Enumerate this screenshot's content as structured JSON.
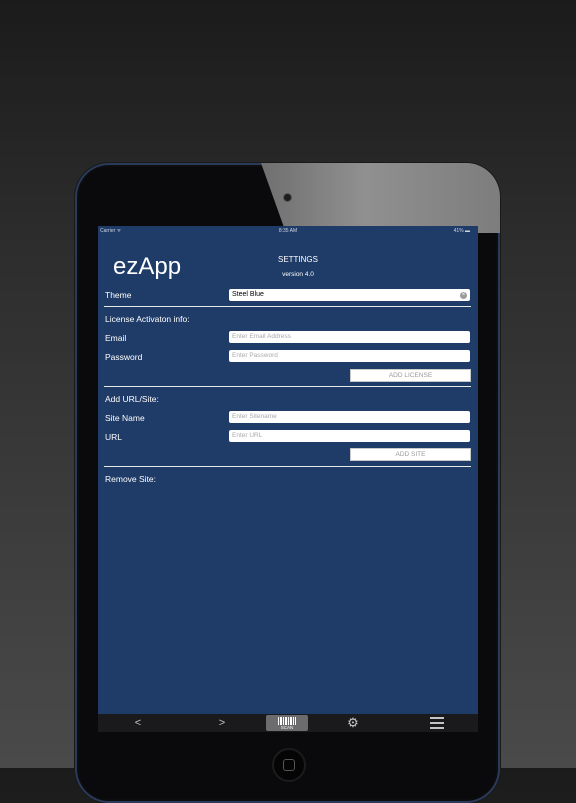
{
  "status_bar": {
    "carrier": "Carrier ᯤ",
    "time": "8:35 AM",
    "battery": "41% ▬"
  },
  "header": {
    "app_name": "ezApp",
    "title": "SETTINGS",
    "version": "version 4.0"
  },
  "theme": {
    "label": "Theme",
    "value": "Steel Blue"
  },
  "license": {
    "section_label": "License Activaton info:",
    "email_label": "Email",
    "email_placeholder": "Enter Email Address",
    "password_label": "Password",
    "password_placeholder": "Enter Password",
    "button": "ADD LICENSE"
  },
  "site": {
    "section_label": "Add URL/Site:",
    "name_label": "Site Name",
    "name_placeholder": "Enter Sitename",
    "url_label": "URL",
    "url_placeholder": "Enter URL",
    "button": "ADD SITE"
  },
  "remove": {
    "section_label": "Remove Site:"
  },
  "toolbar": {
    "back": "<",
    "forward": ">",
    "scan": "SCAN",
    "settings": "⚙"
  },
  "colors": {
    "background": "#1f3b68",
    "toolbar": "#1a1a1c"
  }
}
